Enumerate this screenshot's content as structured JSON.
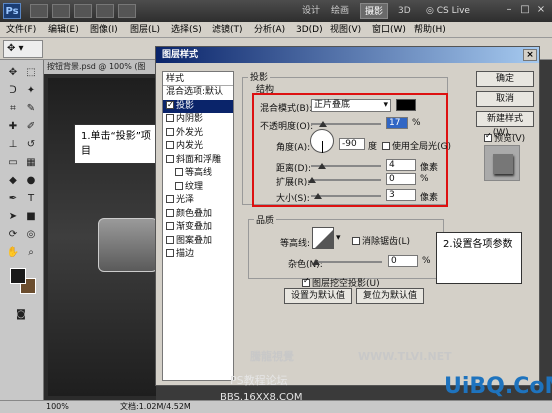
{
  "app": {
    "logo": "Ps",
    "workspaces": [
      "设计",
      "绘画",
      "摄影",
      "3D"
    ],
    "active_workspace": "摄影",
    "cs_live": "CS Live"
  },
  "menu": [
    "文件(F)",
    "编辑(E)",
    "图像(I)",
    "图层(L)",
    "选择(S)",
    "滤镜(T)",
    "分析(A)",
    "3D(D)",
    "视图(V)",
    "窗口(W)",
    "帮助(H)"
  ],
  "document": {
    "tab_label": "按钮背景.psd @ 100% (图",
    "zoom": "100%",
    "file_info": "文档:1.02M/4.52M"
  },
  "callouts": {
    "step1": "1.单击“投影”项目",
    "step2": "2.设置各项参数"
  },
  "dialog": {
    "title": "图层样式",
    "style_header": "样式",
    "blend_item": "混合选项:默认",
    "styles": [
      {
        "label": "投影",
        "checked": true,
        "selected": true
      },
      {
        "label": "内阴影",
        "checked": false
      },
      {
        "label": "外发光",
        "checked": false
      },
      {
        "label": "内发光",
        "checked": false
      },
      {
        "label": "斜面和浮雕",
        "checked": false
      },
      {
        "label": "等高线",
        "checked": false,
        "sub": true
      },
      {
        "label": "纹理",
        "checked": false,
        "sub": true
      },
      {
        "label": "光泽",
        "checked": false
      },
      {
        "label": "颜色叠加",
        "checked": false
      },
      {
        "label": "渐变叠加",
        "checked": false
      },
      {
        "label": "图案叠加",
        "checked": false
      },
      {
        "label": "描边",
        "checked": false
      }
    ],
    "section_title": "投影",
    "structure_title": "结构",
    "blend_mode_label": "混合模式(B):",
    "blend_mode_value": "正片叠底",
    "opacity_label": "不透明度(O):",
    "opacity_value": "17",
    "opacity_unit": "%",
    "opacity_fraction": 0.17,
    "angle_label": "角度(A):",
    "angle_value": "-90",
    "angle_unit": "度",
    "global_light_label": "使用全局光(G)",
    "distance_label": "距离(D):",
    "distance_value": "4",
    "distance_unit": "像素",
    "spread_label": "扩展(R):",
    "spread_value": "0",
    "spread_unit": "%",
    "size_label": "大小(S):",
    "size_value": "3",
    "size_unit": "像素",
    "quality_title": "品质",
    "contour_label": "等高线:",
    "antialias_label": "消除锯齿(L)",
    "noise_label": "杂色(N):",
    "noise_value": "0",
    "noise_unit": "%",
    "knockout_label": "图层挖空投影(U)",
    "make_default": "设置为默认值",
    "reset_default": "复位为默认值",
    "ok": "确定",
    "cancel": "取消",
    "new_style": "新建样式(W)...",
    "preview_label": "预览(V)"
  },
  "watermarks": {
    "tlvi": "WWW.TLVI.NET",
    "brand": "騰龍視覺",
    "forum": "PS教程论坛",
    "bbs": "BBS.16XX8.COM",
    "uibq": "UiBQ.CoM"
  },
  "colors": {
    "accent": "#0a246a",
    "highlight_frame": "#dd1111",
    "shadow_color": "#000000"
  }
}
